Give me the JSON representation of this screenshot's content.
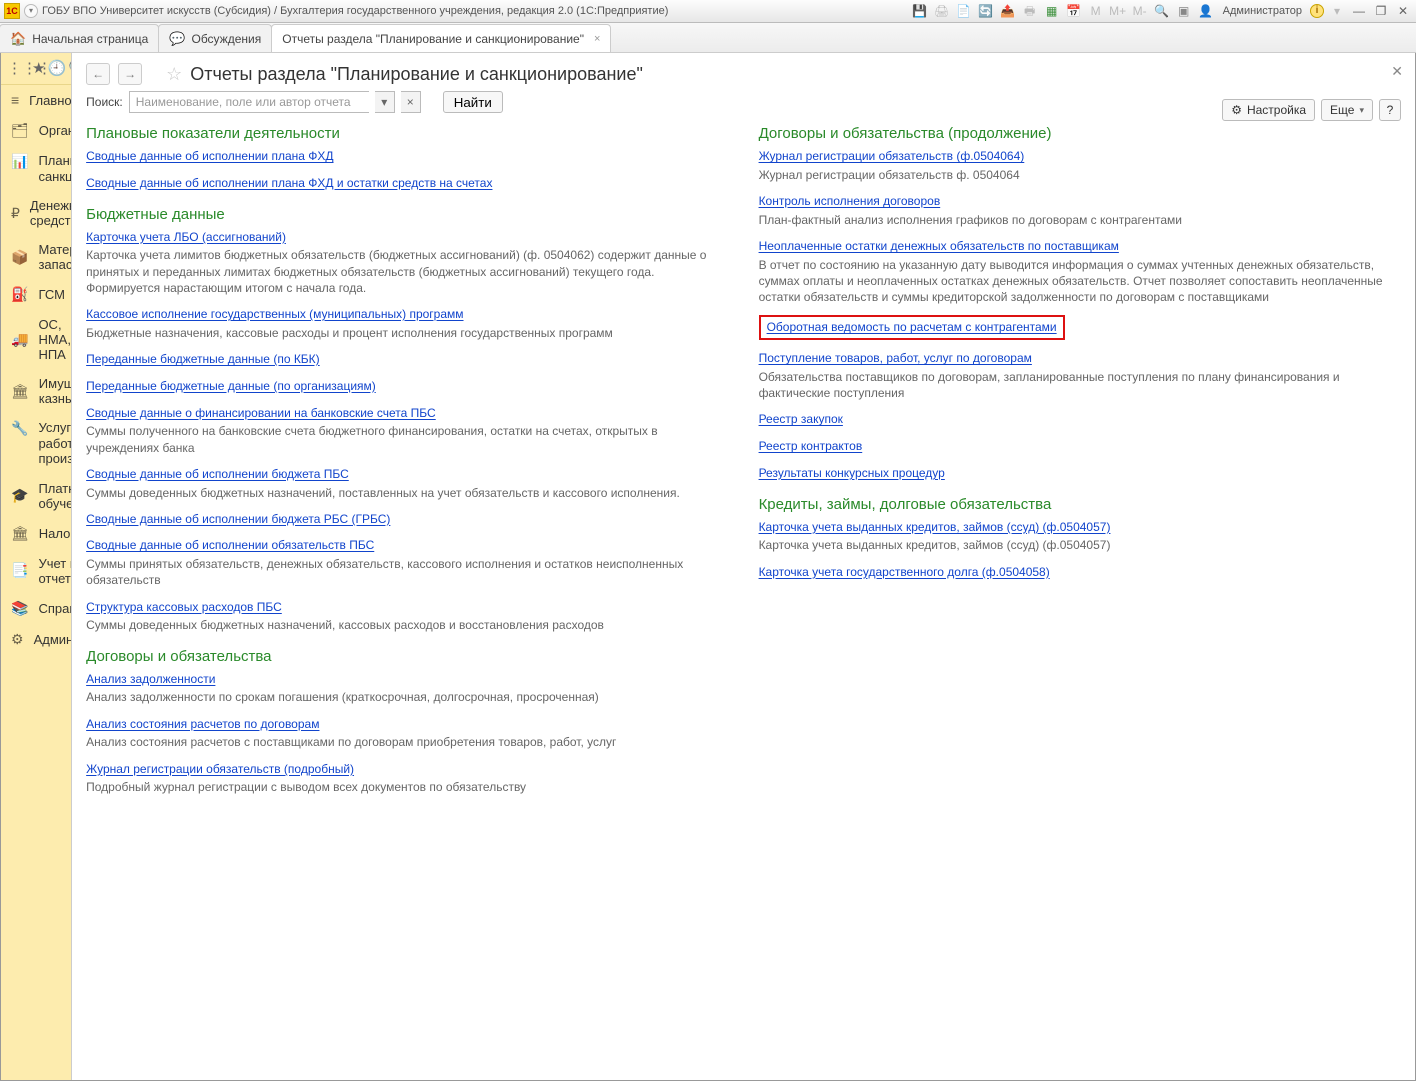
{
  "title_bar": {
    "app": "1C",
    "text": "ГОБУ ВПО Университет искусств (Субсидия) / Бухгалтерия государственного учреждения, редакция 2.0  (1С:Предприятие)",
    "m_labels": [
      "M",
      "M+",
      "M-"
    ],
    "user_label": "Администратор"
  },
  "tabs": [
    {
      "icon": "🏠",
      "label": "Начальная страница",
      "closable": false,
      "active": false
    },
    {
      "icon": "💬",
      "label": "Обсуждения",
      "closable": false,
      "active": false
    },
    {
      "icon": "",
      "label": "Отчеты раздела \"Планирование и санкционирование\"",
      "closable": true,
      "active": true
    }
  ],
  "sidebar": {
    "iconrow": [
      "⋮⋮⋮",
      "★",
      "🕘",
      "🔍",
      "🔔"
    ],
    "items": [
      {
        "icon": "≡",
        "label": "Главное"
      },
      {
        "icon": "🗂",
        "label": "Органайзер"
      },
      {
        "icon": "📊",
        "label": "Планирование и санкционирование"
      },
      {
        "icon": "₽",
        "label": "Денежные средства"
      },
      {
        "icon": "📦",
        "label": "Материальные запасы"
      },
      {
        "icon": "⛽",
        "label": "ГСМ"
      },
      {
        "icon": "🚚",
        "label": "ОС, НМА, НПА"
      },
      {
        "icon": "🏛",
        "label": "Имущество казны"
      },
      {
        "icon": "🔧",
        "label": "Услуги, работы, производство"
      },
      {
        "icon": "🎓",
        "label": "Платное обучение"
      },
      {
        "icon": "🏛",
        "label": "Налоги"
      },
      {
        "icon": "📑",
        "label": "Учет и отчетность"
      },
      {
        "icon": "📚",
        "label": "Справочники"
      },
      {
        "icon": "⚙",
        "label": "Администрирование"
      }
    ]
  },
  "content": {
    "page_title": "Отчеты раздела \"Планирование и санкционирование\"",
    "search_label": "Поиск:",
    "search_placeholder": "Наименование, поле или автор отчета",
    "find_label": "Найти",
    "settings_label": "Настройка",
    "more_label": "Еще",
    "left_sections": [
      {
        "title": "Плановые показатели деятельности",
        "items": [
          {
            "link": "Сводные данные об исполнении плана ФХД"
          },
          {
            "link": "Сводные данные об исполнении плана ФХД и остатки средств на счетах"
          }
        ]
      },
      {
        "title": "Бюджетные данные",
        "items": [
          {
            "link": "Карточка учета ЛБО (ассигнований)",
            "desc": "Карточка учета лимитов бюджетных обязательств (бюджетных ассигнований) (ф. 0504062) содержит\nданные о принятых и переданных лимитах бюджетных обязательств (бюджетных ассигнований) текущего года.\nФормируется нарастающим итогом с начала года."
          },
          {
            "link": "Кассовое исполнение государственных (муниципальных) программ",
            "desc": "Бюджетные назначения, кассовые расходы и процент исполнения государственных программ"
          },
          {
            "link": "Переданные бюджетные данные (по КБК)"
          },
          {
            "link": "Переданные бюджетные данные (по организациям)"
          },
          {
            "link": "Сводные данные о финансировании на банковские счета ПБС",
            "desc": "Суммы полученного на банковские счета бюджетного финансирования, остатки на счетах, открытых в учреждениях банка"
          },
          {
            "link": "Сводные данные об исполнении бюджета ПБС",
            "desc": "Суммы доведенных бюджетных назначений, поставленных на учет обязательств и кассового исполнения."
          },
          {
            "link": "Сводные данные об исполнении бюджета РБС (ГРБС)"
          },
          {
            "link": "Сводные данные об исполнении обязательств ПБС",
            "desc": "Суммы принятых обязательств, денежных обязательств, кассового исполнения и остатков неисполненных обязательств"
          },
          {
            "link": "Структура кассовых расходов ПБС",
            "desc": "Суммы доведенных бюджетных назначений, кассовых расходов и восстановления расходов"
          }
        ]
      },
      {
        "title": "Договоры и обязательства",
        "items": [
          {
            "link": "Анализ задолженности",
            "desc": "Анализ задолженности по срокам погашения (краткосрочная, долгосрочная, просроченная)"
          },
          {
            "link": "Анализ состояния расчетов по договорам",
            "desc": "Анализ состояния расчетов с поставщиками по договорам приобретения товаров, работ, услуг"
          },
          {
            "link": "Журнал регистрации обязательств (подробный)",
            "desc": "Подробный журнал регистрации с выводом всех документов по обязательству"
          }
        ]
      }
    ],
    "right_sections": [
      {
        "title": "Договоры и обязательства (продолжение)",
        "items": [
          {
            "link": "Журнал регистрации обязательств (ф.0504064)",
            "desc": "Журнал регистрации обязательств ф. 0504064"
          },
          {
            "link": "Контроль исполнения договоров",
            "desc": "План-фактный анализ исполнения графиков по договорам с контрагентами"
          },
          {
            "link": "Неоплаченные остатки денежных обязательств по поставщикам",
            "desc": "В отчет по состоянию на указанную дату выводится информация о суммах учтенных денежных обязательств, суммах оплаты и неоплаченных остатках денежных обязательств. Отчет позволяет сопоставить неоплаченные остатки обязательств и суммы кредиторской задолженности по договорам с поставщиками"
          },
          {
            "link": "Оборотная ведомость по расчетам с контрагентами",
            "highlight": true
          },
          {
            "link": "Поступление товаров, работ, услуг по договорам",
            "desc": "Обязательства поставщиков по договорам, запланированные поступления по плану финансирования и фактические поступления"
          },
          {
            "link": "Реестр закупок"
          },
          {
            "link": "Реестр контрактов"
          },
          {
            "link": "Результаты конкурсных процедур"
          }
        ]
      },
      {
        "title": "Кредиты, займы, долговые обязательства",
        "items": [
          {
            "link": "Карточка учета выданных кредитов, займов (ссуд) (ф.0504057)",
            "desc": "Карточка учета выданных кредитов, займов (ссуд) (ф.0504057)"
          },
          {
            "link": "Карточка учета государственного долга (ф.0504058)"
          }
        ]
      }
    ]
  }
}
